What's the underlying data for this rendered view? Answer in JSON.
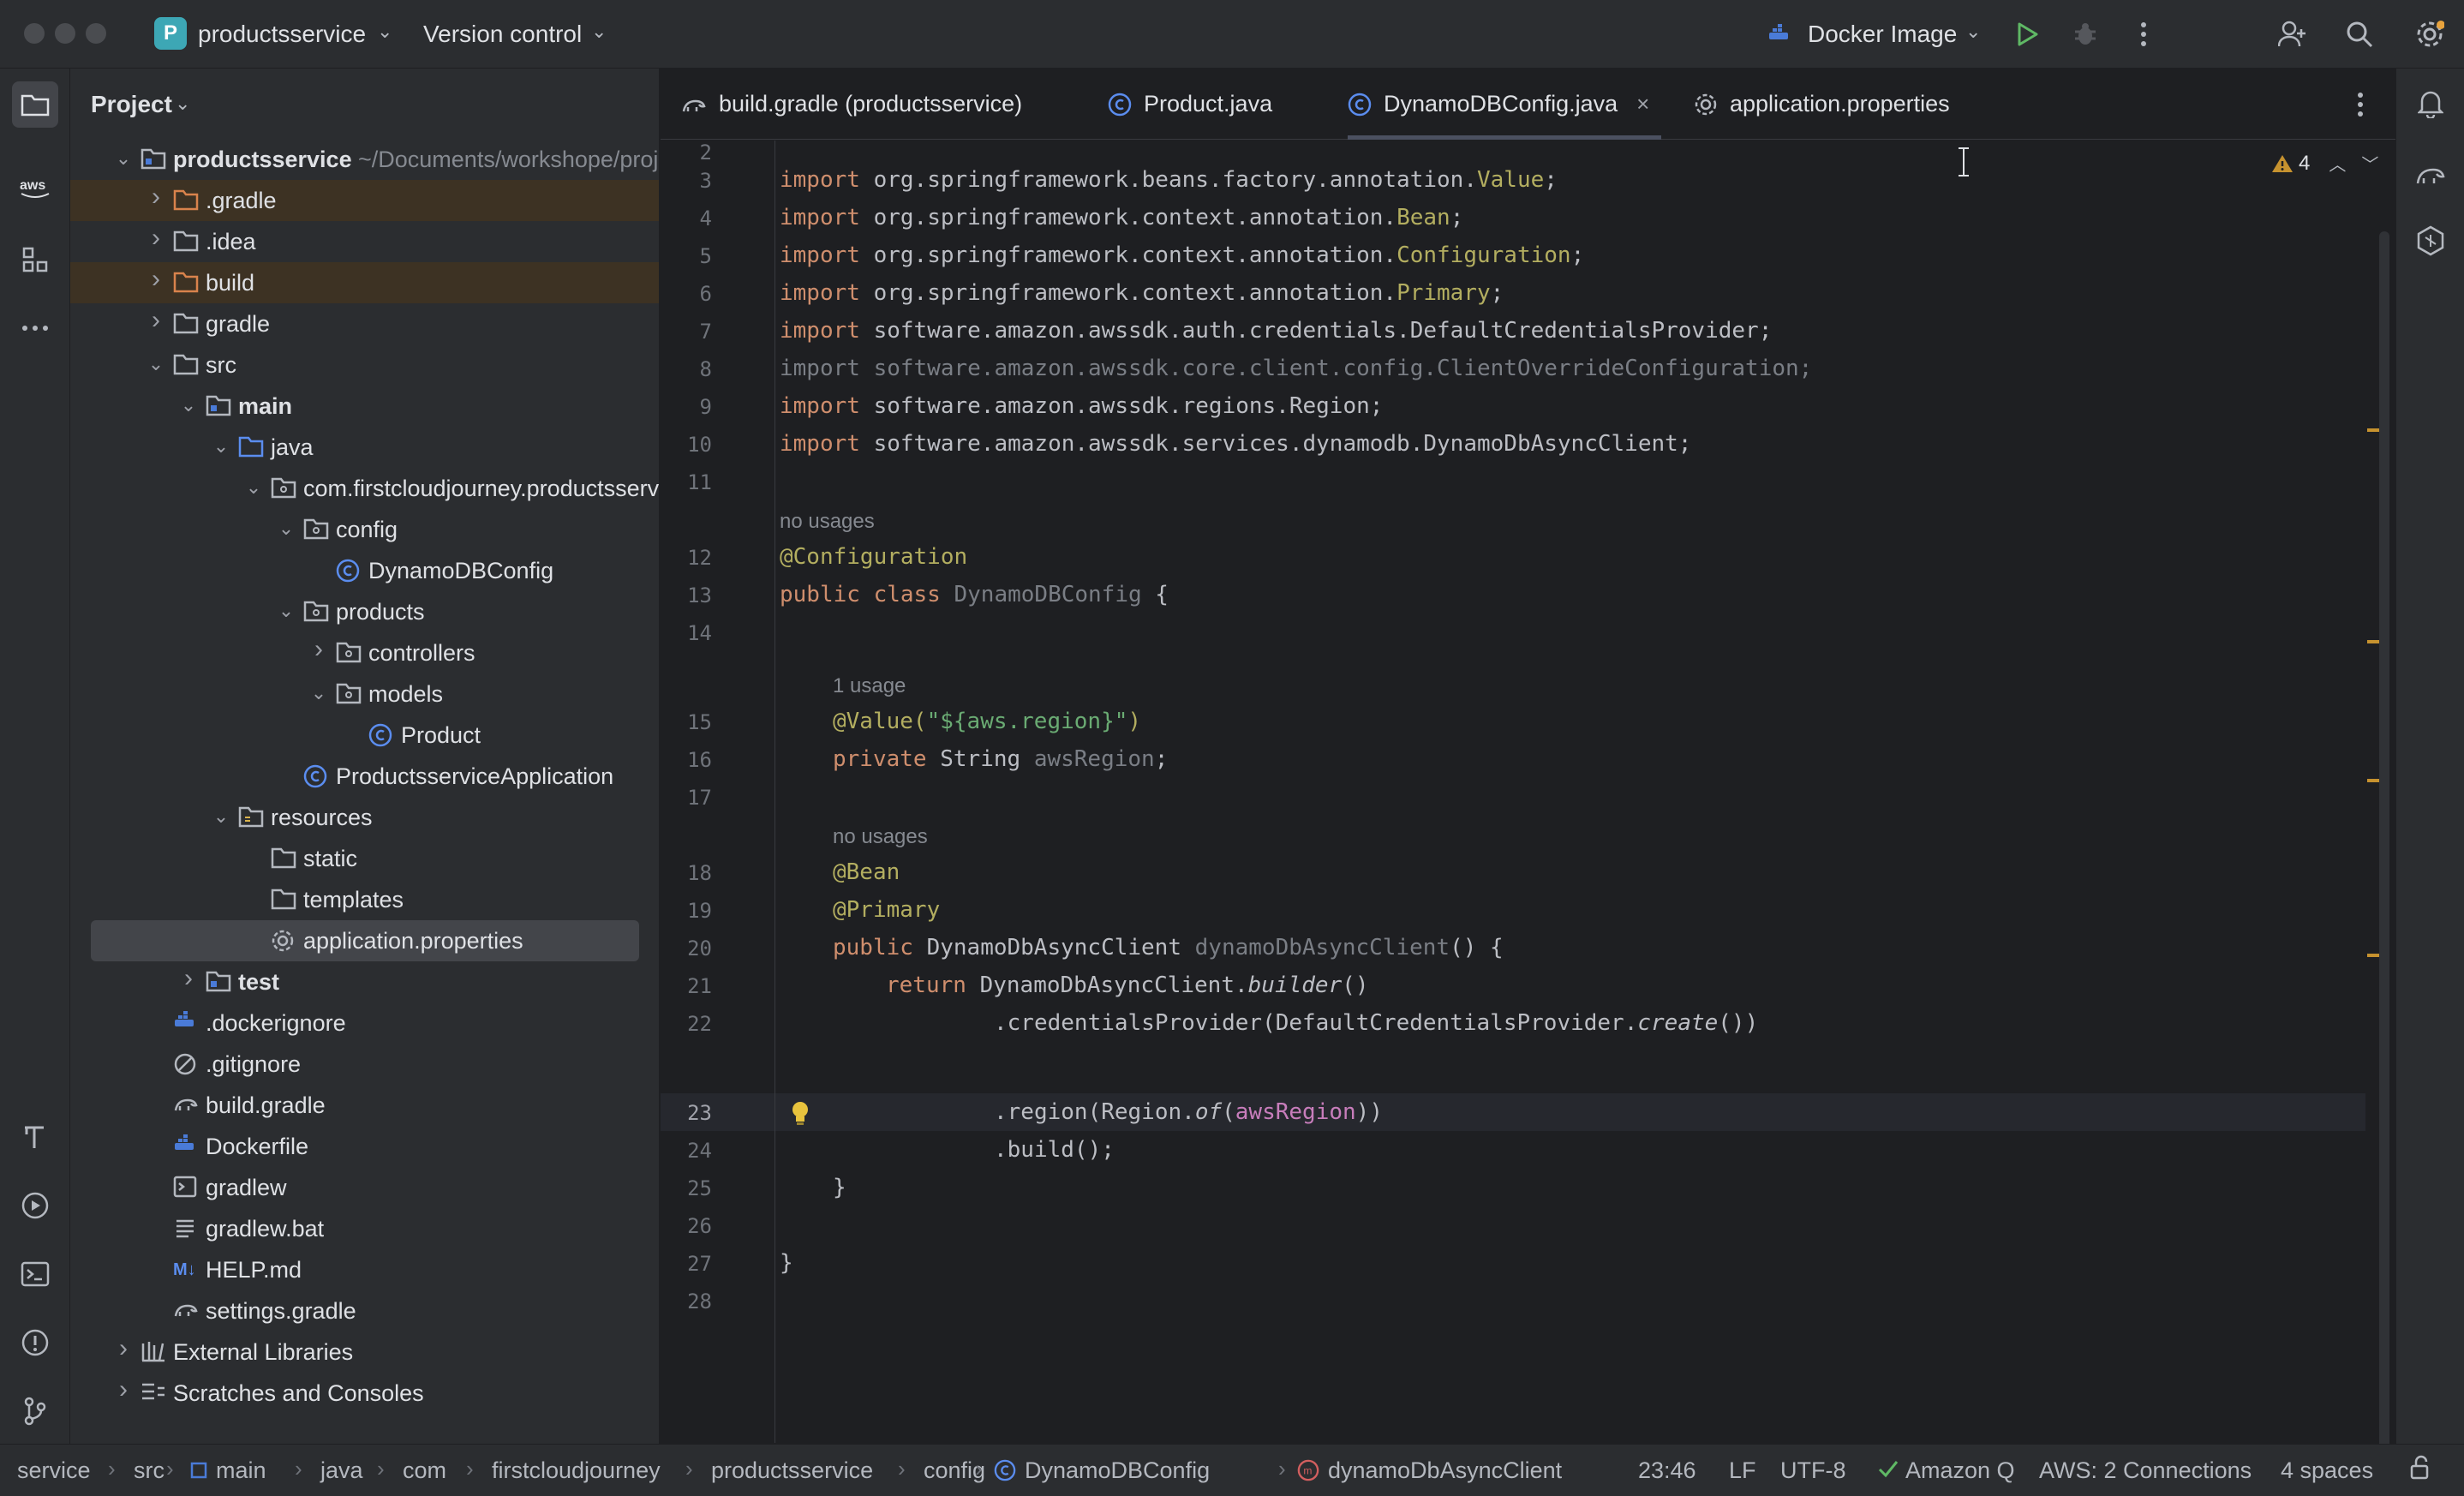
{
  "titlebar": {
    "project_initial": "P",
    "project_name": "productsservice",
    "vcs_label": "Version control",
    "run_config": "Docker Image"
  },
  "project_panel": {
    "title": "Project",
    "tree": [
      {
        "label": "productsservice",
        "suffix": " ~/Documents/workshope/proj"
      },
      {
        "label": ".gradle"
      },
      {
        "label": ".idea"
      },
      {
        "label": "build"
      },
      {
        "label": "gradle"
      },
      {
        "label": "src"
      },
      {
        "label": "main"
      },
      {
        "label": "java"
      },
      {
        "label": "com.firstcloudjourney.productsserv"
      },
      {
        "label": "config"
      },
      {
        "label": "DynamoDBConfig"
      },
      {
        "label": "products"
      },
      {
        "label": "controllers"
      },
      {
        "label": "models"
      },
      {
        "label": "Product"
      },
      {
        "label": "ProductsserviceApplication"
      },
      {
        "label": "resources"
      },
      {
        "label": "static"
      },
      {
        "label": "templates"
      },
      {
        "label": "application.properties"
      },
      {
        "label": "test"
      },
      {
        "label": ".dockerignore"
      },
      {
        "label": ".gitignore"
      },
      {
        "label": "build.gradle"
      },
      {
        "label": "Dockerfile"
      },
      {
        "label": "gradlew"
      },
      {
        "label": "gradlew.bat"
      },
      {
        "label": "HELP.md"
      },
      {
        "label": "settings.gradle"
      },
      {
        "label": "External Libraries"
      },
      {
        "label": "Scratches and Consoles"
      }
    ]
  },
  "tabs": [
    {
      "label": "build.gradle (productsservice)"
    },
    {
      "label": "Product.java"
    },
    {
      "label": "DynamoDBConfig.java"
    },
    {
      "label": "application.properties"
    }
  ],
  "editor": {
    "warning_count": "4",
    "line_numbers": [
      "2",
      "3",
      "4",
      "5",
      "6",
      "7",
      "8",
      "9",
      "10",
      "11",
      "12",
      "13",
      "14",
      "15",
      "16",
      "17",
      "18",
      "19",
      "20",
      "21",
      "22",
      "23",
      "24",
      "25",
      "26",
      "27",
      "28"
    ],
    "hints": [
      "no usages",
      "1 usage",
      "no usages"
    ],
    "code": {
      "l3": [
        "import org.springframework.beans.factory.annotation.",
        "Value",
        ";"
      ],
      "l4": [
        "import org.springframework.context.annotation.",
        "Bean",
        ";"
      ],
      "l5": [
        "import org.springframework.context.annotation.",
        "Configuration",
        ";"
      ],
      "l6": [
        "import org.springframework.context.annotation.",
        "Primary",
        ";"
      ],
      "l7": "import software.amazon.awssdk.auth.credentials.DefaultCredentialsProvider;",
      "l8": "import software.amazon.awssdk.core.client.config.ClientOverrideConfiguration;",
      "l9": "import software.amazon.awssdk.regions.Region;",
      "l10": "import software.amazon.awssdk.services.dynamodb.DynamoDbAsyncClient;",
      "l12": "@Configuration",
      "l13": [
        "public class ",
        "DynamoDBConfig",
        " {"
      ],
      "l15": [
        "@Value(",
        "\"${aws.region}\"",
        ")"
      ],
      "l16": [
        "private ",
        "String ",
        "awsRegion",
        ";"
      ],
      "l18": "@Bean",
      "l19": "@Primary",
      "l20": [
        "public ",
        "DynamoDbAsyncClient ",
        "dynamoDbAsyncClient",
        "() {"
      ],
      "l21": [
        "return ",
        "DynamoDbAsyncClient.",
        "builder",
        "()"
      ],
      "l22": [
        ".credentialsProvider(DefaultCredentialsProvider.",
        "create",
        "())"
      ],
      "l23": [
        ".region(Region.",
        "of",
        "(",
        "awsRegion",
        "))"
      ],
      "l24": ".build();",
      "l25": "}",
      "l27": "}"
    }
  },
  "statusbar": {
    "breadcrumbs": [
      "service",
      "src",
      "main",
      "java",
      "com",
      "firstcloudjourney",
      "productsservice",
      "config",
      "DynamoDBConfig",
      "dynamoDbAsyncClient"
    ],
    "position": "23:46",
    "line_sep": "LF",
    "encoding": "UTF-8",
    "amazon_q": "Amazon Q",
    "aws": "AWS: 2 Connections",
    "indent": "4 spaces"
  },
  "colors": {
    "background": "#1e1f22",
    "panel": "#2b2d30",
    "keyword": "#cf8e6d",
    "annotation": "#b3ae60",
    "string": "#6aab73",
    "field": "#c77dbb",
    "warning": "#c6922f"
  }
}
